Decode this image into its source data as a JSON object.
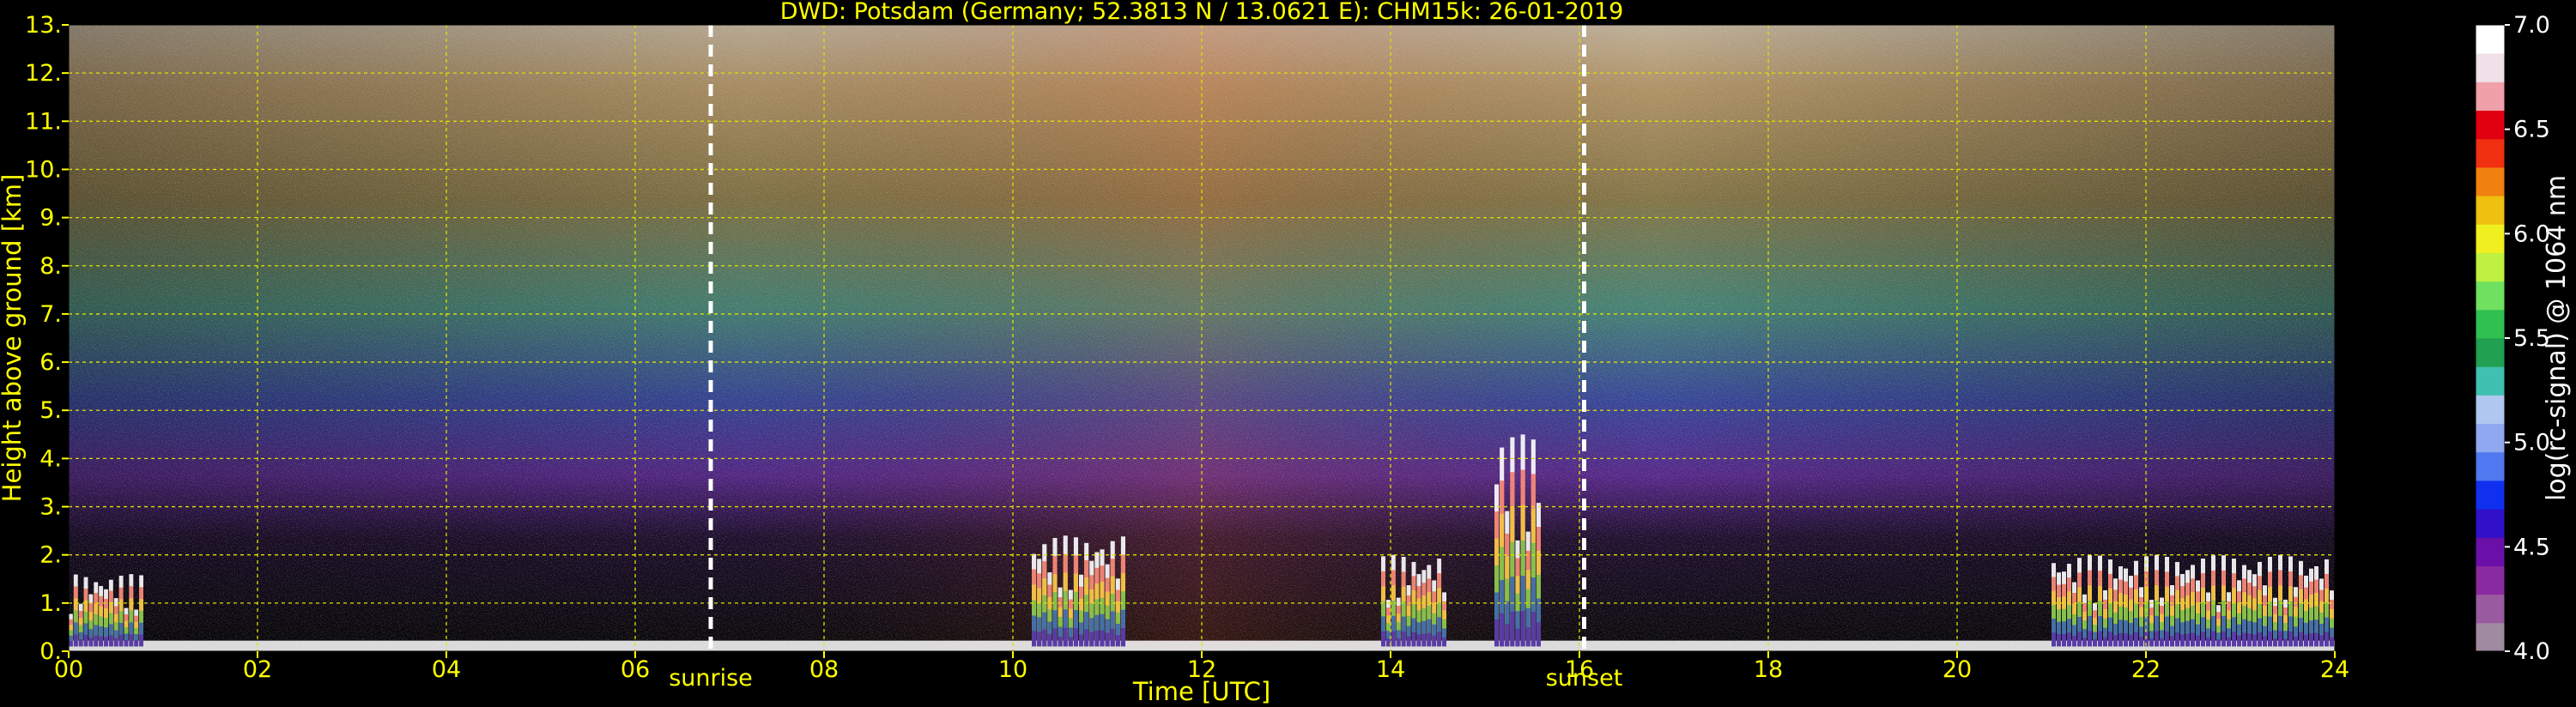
{
  "chart_data": {
    "type": "heatmap",
    "title": "DWD: Potsdam (Germany; 52.3813 N / 13.0621 E):    CHM15k: 26-01-2019",
    "xlabel": "Time [UTC]",
    "ylabel": "Height above ground [km]",
    "xlim": [
      0,
      24
    ],
    "ylim": [
      0,
      13
    ],
    "x_ticks": [
      "00",
      "02",
      "04",
      "06",
      "08",
      "10",
      "12",
      "14",
      "16",
      "18",
      "20",
      "22",
      "24"
    ],
    "y_ticks": [
      "0.",
      "1.",
      "2.",
      "3.",
      "4.",
      "5.",
      "6.",
      "7.",
      "8.",
      "9.",
      "10.",
      "11.",
      "12.",
      "13."
    ],
    "grid": true,
    "markers": [
      {
        "label": "sunrise",
        "x": 6.8
      },
      {
        "label": "sunset",
        "x": 16.05
      }
    ],
    "colorbar": {
      "label": "log(rc-signal) @ 1064 nm",
      "range": [
        4.0,
        7.0
      ],
      "ticks": [
        "4.0",
        "4.5",
        "5.0",
        "5.5",
        "6.0",
        "6.5",
        "7.0"
      ],
      "colors": [
        "#a08aa0",
        "#9a5aa0",
        "#8a2aa0",
        "#6a10a8",
        "#3010c8",
        "#1030f0",
        "#5078f0",
        "#90a8f0",
        "#b0c8f0",
        "#40c0b0",
        "#20a050",
        "#30c050",
        "#70e060",
        "#c0f040",
        "#f0f020",
        "#f0c010",
        "#f08010",
        "#f03010",
        "#e00010",
        "#f0a0a8",
        "#f0e0e8",
        "#ffffff"
      ]
    },
    "cloud_features": [
      {
        "x_start": 0.0,
        "x_end": 0.8,
        "height_top": 1.6
      },
      {
        "x_start": 10.2,
        "x_end": 11.2,
        "height_top": 2.4
      },
      {
        "x_start": 13.9,
        "x_end": 14.6,
        "height_top": 2.0
      },
      {
        "x_start": 15.1,
        "x_end": 15.6,
        "height_top": 4.5
      },
      {
        "x_start": 21.0,
        "x_end": 24.0,
        "height_top": 2.0
      }
    ],
    "background_colors": [
      "#8a6a5a",
      "#9a8050",
      "#b06040",
      "#70a070",
      "#3a4a9a",
      "#5a3aa0",
      "#111111"
    ]
  }
}
